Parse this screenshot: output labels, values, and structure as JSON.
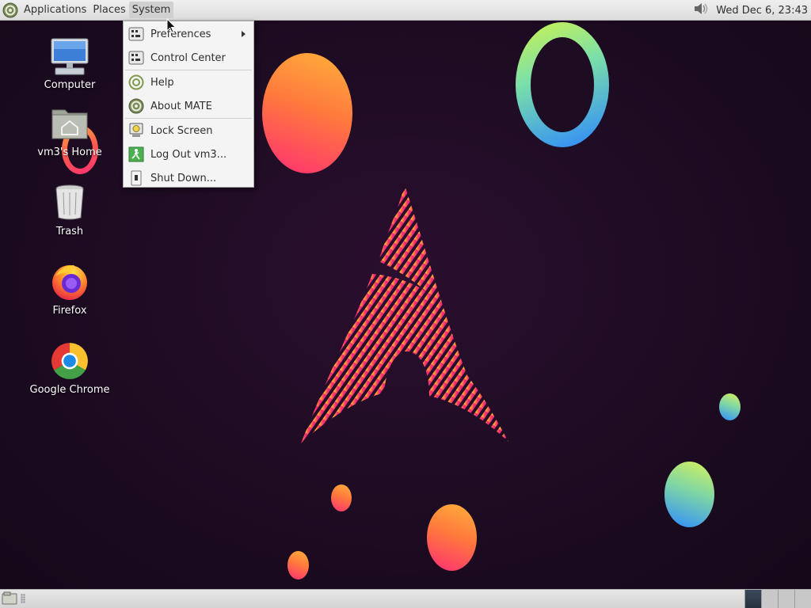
{
  "top_panel": {
    "menus": [
      {
        "label": "Applications"
      },
      {
        "label": "Places"
      },
      {
        "label": "System"
      }
    ],
    "clock": "Wed Dec  6, 23:43"
  },
  "desktop_icons": [
    {
      "label": "Computer",
      "icon": "computer-icon"
    },
    {
      "label": "vm3's Home",
      "icon": "home-folder-icon"
    },
    {
      "label": "Trash",
      "icon": "trash-icon"
    },
    {
      "label": "Firefox",
      "icon": "firefox-icon"
    },
    {
      "label": "Google Chrome",
      "icon": "chrome-icon"
    }
  ],
  "system_menu": {
    "items": [
      {
        "label": "Preferences",
        "icon": "preferences-icon",
        "submenu": true
      },
      {
        "label": "Control Center",
        "icon": "control-center-icon"
      },
      {
        "label": "Help",
        "icon": "help-icon"
      },
      {
        "label": "About MATE",
        "icon": "mate-logo-icon"
      },
      {
        "label": "Lock Screen",
        "icon": "lock-screen-icon"
      },
      {
        "label": "Log Out vm3...",
        "icon": "logout-icon"
      },
      {
        "label": "Shut Down...",
        "icon": "shutdown-icon"
      }
    ]
  },
  "bottom_panel": {
    "workspaces": 4,
    "active_workspace": 1
  },
  "colors": {
    "panel_bg": "#e3e3e3",
    "desktop_bg": "#1e0c22",
    "menu_bg": "#f4f4f4",
    "accent_warm": "#ff2f73",
    "accent_cool": "#2e8cff"
  }
}
